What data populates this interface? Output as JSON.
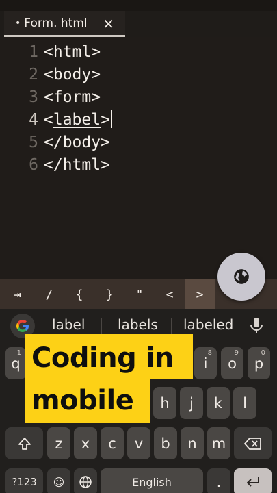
{
  "tab": {
    "dot": "•",
    "title": "Form. html",
    "close_glyph": "✕"
  },
  "editor": {
    "lines": [
      {
        "num": "1",
        "text": "<html>"
      },
      {
        "num": "2",
        "text": "<body>"
      },
      {
        "num": "3",
        "text": "<form>"
      },
      {
        "num": "4",
        "prefix": "<",
        "word": "label",
        "suffix": ">"
      },
      {
        "num": "5",
        "text": "</body>"
      },
      {
        "num": "6",
        "text": "</html>"
      }
    ],
    "active_line": 4
  },
  "fab": {
    "icon": "globe-icon"
  },
  "symbols": [
    "⇥",
    "/",
    "{",
    "}",
    "\"",
    "<",
    ">"
  ],
  "keyboard": {
    "suggestions": [
      "label",
      "labels",
      "labeled"
    ],
    "row1": [
      {
        "label": "q",
        "sup": "1"
      },
      {
        "label": "i",
        "sup": "8"
      },
      {
        "label": "o",
        "sup": "9"
      },
      {
        "label": "p",
        "sup": "0"
      }
    ],
    "row2": [
      "h",
      "j",
      "k",
      "l"
    ],
    "row3": [
      "z",
      "x",
      "c",
      "v",
      "b",
      "n",
      "m"
    ],
    "row4": {
      "symbols": "?123",
      "emoji": "☺",
      "space": "English",
      "period": "."
    }
  },
  "overlay": {
    "line1": "Coding in",
    "line2": "mobile"
  },
  "colors": {
    "overlay_bg": "#fdd116",
    "editor_bg": "#201c19",
    "symbar_bg": "#3a302a"
  }
}
